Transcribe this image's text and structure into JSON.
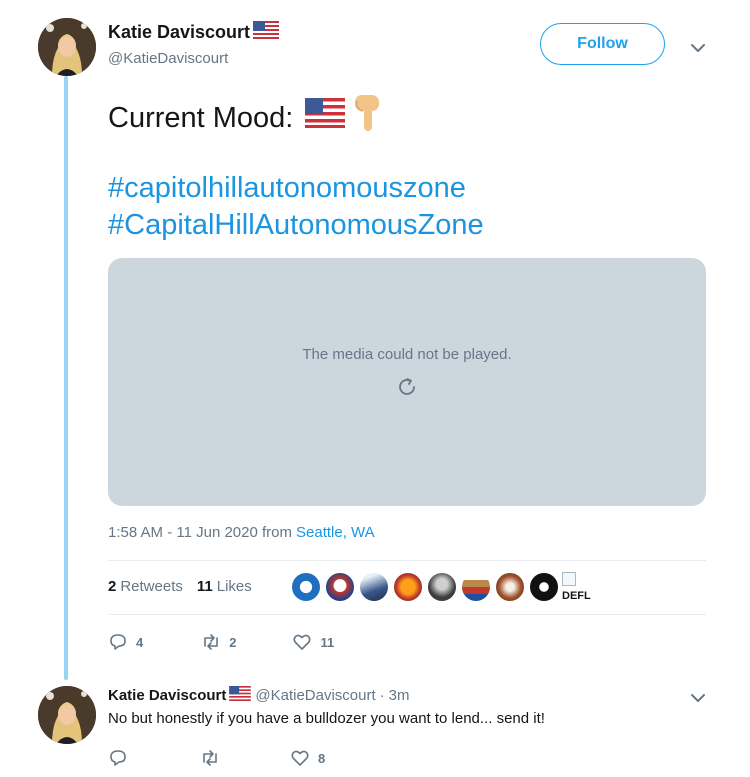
{
  "main_tweet": {
    "display_name": "Katie Daviscourt",
    "handle": "@KatieDaviscourt",
    "follow_label": "Follow",
    "text": "Current Mood:",
    "hashtags": [
      "#capitolhillautonomouszone",
      "#CapitalHillAutonomousZone"
    ],
    "media_message": "The media could not be played.",
    "time": "1:58 AM - 11 Jun 2020 from",
    "location": "Seattle, WA",
    "stats": {
      "retweets_count": "2",
      "retweets_label": "Retweets",
      "likes_count": "11",
      "likes_label": "Likes"
    },
    "broken_liker_alt": "DEFL",
    "actions": {
      "reply": "4",
      "retweet": "2",
      "like": "11"
    }
  },
  "reply_tweet": {
    "display_name": "Katie Daviscourt",
    "handle": "@KatieDaviscourt",
    "separator": "·",
    "time": "3m",
    "text": "No but honestly if you have a bulldozer you want to lend... send it!",
    "actions": {
      "reply": "",
      "retweet": "",
      "like": "8"
    }
  },
  "colors": {
    "accent": "#1da1f2",
    "link": "#1b95e0",
    "thread_line": "#9ad4f3",
    "media_bg": "#ccd6dd",
    "secondary_text": "#657786"
  }
}
